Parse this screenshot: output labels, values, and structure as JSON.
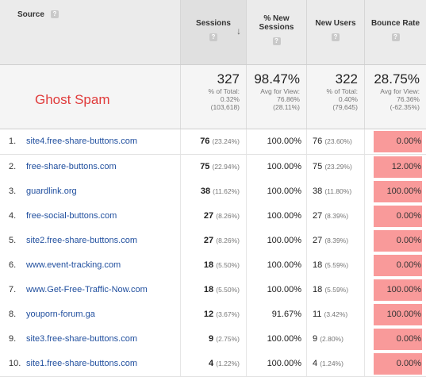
{
  "header": {
    "source": "Source",
    "sessions": "Sessions",
    "new_sessions_line1": "% New",
    "new_sessions_line2": "Sessions",
    "new_users": "New Users",
    "bounce_rate": "Bounce Rate",
    "help_glyph": "?",
    "sort_glyph": "↓"
  },
  "summary": {
    "label": "Ghost Spam",
    "sessions": {
      "value": "327",
      "line1": "% of Total:",
      "line2": "0.32%",
      "line3": "(103,618)"
    },
    "new_sessions": {
      "value": "98.47%",
      "line1": "Avg for View:",
      "line2": "76.86%",
      "line3": "(28.11%)"
    },
    "new_users": {
      "value": "322",
      "line1": "% of Total:",
      "line2": "0.40%",
      "line3": "(79,645)"
    },
    "bounce": {
      "value": "28.75%",
      "line1": "Avg for View:",
      "line2": "76.36%",
      "line3": "(-62.35%)"
    }
  },
  "rows": [
    {
      "num": "1.",
      "source": "site4.free-share-buttons.com",
      "sessions": "76",
      "sessions_pct": "(23.24%)",
      "new_sessions": "100.00%",
      "new_users": "76",
      "new_users_pct": "(23.60%)",
      "bounce": "0.00%"
    },
    {
      "num": "2.",
      "source": "free-share-buttons.com",
      "sessions": "75",
      "sessions_pct": "(22.94%)",
      "new_sessions": "100.00%",
      "new_users": "75",
      "new_users_pct": "(23.29%)",
      "bounce": "12.00%"
    },
    {
      "num": "3.",
      "source": "guardlink.org",
      "sessions": "38",
      "sessions_pct": "(11.62%)",
      "new_sessions": "100.00%",
      "new_users": "38",
      "new_users_pct": "(11.80%)",
      "bounce": "100.00%"
    },
    {
      "num": "4.",
      "source": "free-social-buttons.com",
      "sessions": "27",
      "sessions_pct": "(8.26%)",
      "new_sessions": "100.00%",
      "new_users": "27",
      "new_users_pct": "(8.39%)",
      "bounce": "0.00%"
    },
    {
      "num": "5.",
      "source": "site2.free-share-buttons.com",
      "sessions": "27",
      "sessions_pct": "(8.26%)",
      "new_sessions": "100.00%",
      "new_users": "27",
      "new_users_pct": "(8.39%)",
      "bounce": "0.00%"
    },
    {
      "num": "6.",
      "source": "www.event-tracking.com",
      "sessions": "18",
      "sessions_pct": "(5.50%)",
      "new_sessions": "100.00%",
      "new_users": "18",
      "new_users_pct": "(5.59%)",
      "bounce": "0.00%"
    },
    {
      "num": "7.",
      "source": "www.Get-Free-Traffic-Now.com",
      "sessions": "18",
      "sessions_pct": "(5.50%)",
      "new_sessions": "100.00%",
      "new_users": "18",
      "new_users_pct": "(5.59%)",
      "bounce": "100.00%"
    },
    {
      "num": "8.",
      "source": "youporn-forum.ga",
      "sessions": "12",
      "sessions_pct": "(3.67%)",
      "new_sessions": "91.67%",
      "new_users": "11",
      "new_users_pct": "(3.42%)",
      "bounce": "100.00%"
    },
    {
      "num": "9.",
      "source": "site3.free-share-buttons.com",
      "sessions": "9",
      "sessions_pct": "(2.75%)",
      "new_sessions": "100.00%",
      "new_users": "9",
      "new_users_pct": "(2.80%)",
      "bounce": "0.00%"
    },
    {
      "num": "10.",
      "source": "site1.free-share-buttons.com",
      "sessions": "4",
      "sessions_pct": "(1.22%)",
      "new_sessions": "100.00%",
      "new_users": "4",
      "new_users_pct": "(1.24%)",
      "bounce": "0.00%"
    }
  ],
  "colors": {
    "bounce_highlight": "#f99a9a",
    "ghost_label": "#e03b3b",
    "link": "#1f4e9e"
  }
}
